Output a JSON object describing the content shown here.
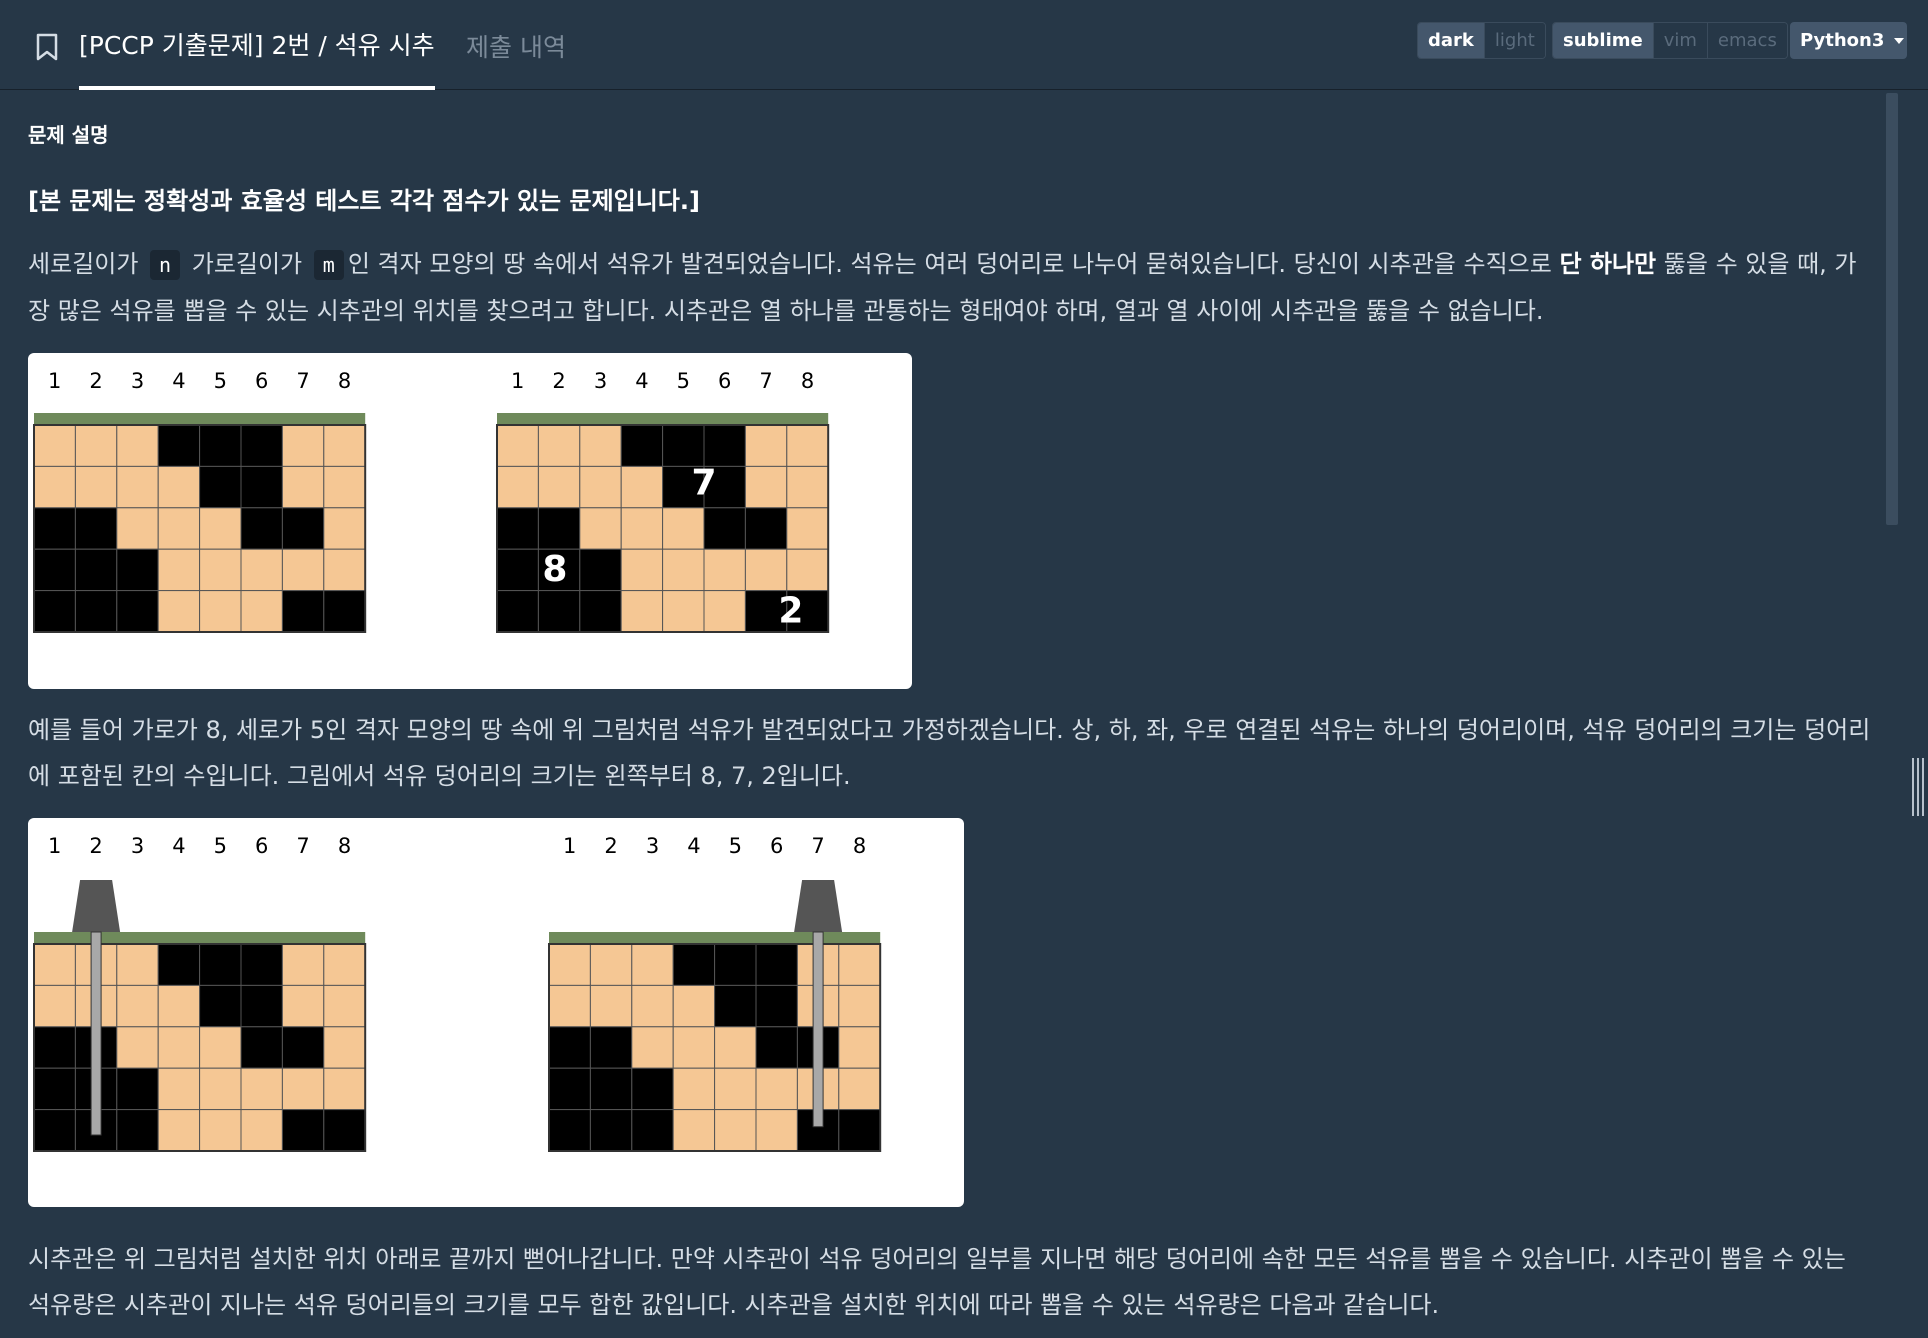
{
  "header": {
    "problem_tab": "[PCCP 기출문제] 2번 / 석유 시추",
    "history_tab": "제출 내역",
    "theme_options": [
      "dark",
      "light"
    ],
    "theme_active": "dark",
    "keymap_options": [
      "sublime",
      "vim",
      "emacs"
    ],
    "keymap_active": "sublime",
    "language": "Python3",
    "icons": {
      "bookmark": "bookmark-icon",
      "language_caret": "caret-down-icon"
    }
  },
  "problem": {
    "section_title": "문제 설명",
    "notice": "[본 문제는 정확성과 효율성 테스트 각각 점수가 있는 문제입니다.]",
    "p1": {
      "t1": "세로길이가",
      "code_n": "n",
      "t2": "가로길이가",
      "code_m": "m",
      "t3": "인 격자 모양의 땅 속에서 석유가 발견되었습니다. 석유는 여러 덩어리로 나누어 묻혀있습니다. 당신이 시추관을 수직으로",
      "bold": "단 하나만",
      "t4": "뚫을 수 있을 때, 가장 많은 석유를 뽑을 수 있는 시추관의 위치를 찾으려고 합니다. 시추관은 열 하나를 관통하는 형태여야 하며, 열과 열 사이에 시추관을 뚫을 수 없습니다."
    },
    "p2": "예를 들어 가로가 8, 세로가 5인 격자 모양의 땅 속에 위 그림처럼 석유가 발견되었다고 가정하겠습니다. 상, 하, 좌, 우로 연결된 석유는 하나의 덩어리이며, 석유 덩어리의 크기는 덩어리에 포함된 칸의 수입니다. 그림에서 석유 덩어리의 크기는 왼쪽부터 8, 7, 2입니다.",
    "p3": "시추관은 위 그림처럼 설치한 위치 아래로 끝까지 뻗어나갑니다. 만약 시추관이 석유 덩어리의 일부를 지나면 해당 덩어리에 속한 모든 석유를 뽑을 수 있습니다. 시추관이 뽑을 수 있는 석유량은 시추관이 지나는 석유 덩어리들의 크기를 모두 합한 값입니다. 시추관을 설치한 위치에 따라 뽑을 수 있는 석유량은 다음과 같습니다."
  },
  "figures": {
    "column_labels": [
      "1",
      "2",
      "3",
      "4",
      "5",
      "6",
      "7",
      "8"
    ],
    "grid": [
      [
        0,
        0,
        0,
        1,
        1,
        1,
        0,
        0
      ],
      [
        0,
        0,
        0,
        0,
        1,
        1,
        0,
        0
      ],
      [
        1,
        1,
        0,
        0,
        0,
        1,
        1,
        0
      ],
      [
        1,
        1,
        1,
        0,
        0,
        0,
        0,
        0
      ],
      [
        1,
        1,
        1,
        0,
        0,
        0,
        1,
        1
      ]
    ],
    "chunk_labels": [
      "7",
      "8",
      "2"
    ],
    "drill_columns": [
      2,
      7
    ],
    "colors": {
      "oil": "#000000",
      "soil": "#f5c794",
      "surface": "#6f8a5b",
      "pipe": "#a8a8a8",
      "drill": "#555555"
    }
  }
}
